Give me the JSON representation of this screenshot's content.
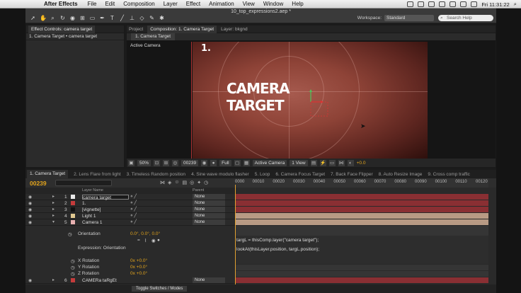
{
  "menubar": {
    "app": "After Effects",
    "items": [
      "File",
      "Edit",
      "Composition",
      "Layer",
      "Effect",
      "Animation",
      "View",
      "Window",
      "Help"
    ],
    "clock": "Fri 11:31:22"
  },
  "window": {
    "title": "10_top_expressions2.aep *",
    "workspace_label": "Workspace:",
    "workspace_value": "Standard",
    "search_help": "Search Help"
  },
  "effect_panel": {
    "tab": "Effect Controls: camera target",
    "subtitle": "1. Camera Target • camera target"
  },
  "comp_panel": {
    "tabs": [
      "Project",
      "Composition: 1. Camera Target",
      "Layer: bkgnd"
    ],
    "subtab": "1. Camera Target",
    "active_camera": "Active Camera",
    "comp_number": "1.",
    "title_line1": "CAMERA",
    "title_line2": "TARGET",
    "footer": {
      "zoom": "50%",
      "timecode": "00239",
      "resolution": "Full",
      "camera": "Active Camera",
      "views": "1 View",
      "exposure": "+0.0"
    }
  },
  "timeline": {
    "tabs": [
      "1. Camera Target",
      "2. Lens Flare from light",
      "3. Timeless Random position",
      "4. Sine wave modulo flasher",
      "5. Loop",
      "6. Camera Focus Target",
      "7. Back Face Flipper",
      "8. Auto Resize Image",
      "9. Cross comp traffic"
    ],
    "timecode": "00239",
    "ruler_ticks": [
      "0000",
      "00010",
      "00020",
      "00030",
      "00040",
      "00050",
      "00060",
      "00070",
      "00080",
      "00090",
      "00100",
      "00110",
      "00120"
    ],
    "col_layer_name": "Layer Name",
    "col_parent": "Parent",
    "layers": [
      {
        "num": "1",
        "name": "camera target",
        "color": "#e8e8e8",
        "parent": "None",
        "selected": true
      },
      {
        "num": "2",
        "name": "1.",
        "color": "#c43b3b",
        "parent": "None",
        "selected": false
      },
      {
        "num": "3",
        "name": "[vignette]",
        "color": "#111111",
        "parent": "None",
        "selected": false
      },
      {
        "num": "4",
        "name": "Light 1",
        "color": "#e0c890",
        "parent": "None",
        "selected": false
      },
      {
        "num": "5",
        "name": "Camera 1",
        "color": "#e8b0b0",
        "parent": "None",
        "selected": false
      }
    ],
    "orientation_label": "Orientation",
    "orientation_value": "0.0°, 0.0°, 0.0°",
    "expression_label": "Expression: Orientation",
    "expression_line1": "targL = thisComp.layer(\"camera target\");",
    "expression_line2": "lookAt(thisLayer.position, targL.position);",
    "rotations": [
      {
        "label": "X Rotation",
        "value": "0x +0.0°"
      },
      {
        "label": "Y Rotation",
        "value": "0x +0.0°"
      },
      {
        "label": "Z Rotation",
        "value": "0x +0.0°"
      }
    ],
    "layer6": {
      "num": "6",
      "name": "CAMERa taRgEt",
      "parent": "None"
    },
    "toggle": "Toggle Switches / Modes"
  },
  "colors": {
    "accent_timecode": "#e3a41c",
    "track_red": "#8a2f33",
    "track_tan": "#b89a84"
  }
}
